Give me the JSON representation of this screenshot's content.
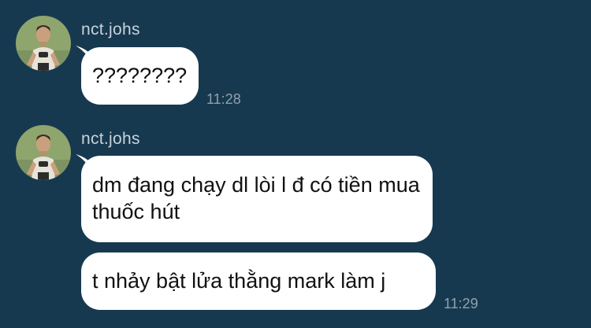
{
  "chat": {
    "messages": [
      {
        "sender": "nct.johs",
        "bubbles": [
          {
            "text": "????????",
            "time": "11:28"
          }
        ]
      },
      {
        "sender": "nct.johs",
        "bubbles": [
          {
            "text": "dm đang chạy dl lòi l đ có tiền mua thuốc hút",
            "time": ""
          },
          {
            "text": "t nhảy bật lửa thằng mark làm j",
            "time": "11:29"
          }
        ]
      }
    ]
  },
  "icons": {
    "avatar": "user-avatar-icon",
    "bubble_tail": "bubble-tail-icon"
  },
  "colors": {
    "background": "#17394f",
    "bubble": "#ffffff",
    "sender_text": "#c7d3db",
    "time_text": "#8fa1ae",
    "avatar_bg": "#8fa56e"
  }
}
